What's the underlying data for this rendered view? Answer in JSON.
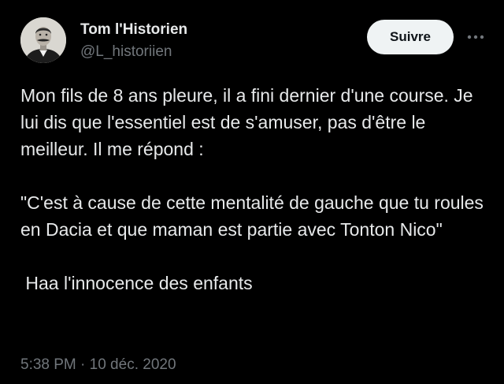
{
  "author": {
    "display_name": "Tom l'Historien",
    "handle": "@L_historiien",
    "avatar_icon": "portrait-avatar"
  },
  "actions": {
    "follow_label": "Suivre",
    "more_icon": "more-horizontal-icon"
  },
  "tweet": {
    "paragraphs": [
      "Mon fils de 8 ans pleure, il a fini dernier d'une course. Je lui dis que l'essentiel est de s'amuser, pas d'être le meilleur. Il me répond :",
      "\"C'est à cause de cette mentalité de gauche que tu roules en Dacia et que maman est partie avec Tonton Nico\"",
      " Haa l'innocence des enfants"
    ],
    "timestamp": "5:38 PM · 10 déc. 2020"
  },
  "colors": {
    "background": "#000000",
    "primary_text": "#e7e9ea",
    "secondary_text": "#71767b",
    "button_bg": "#eff3f4",
    "button_text": "#0f1419"
  }
}
